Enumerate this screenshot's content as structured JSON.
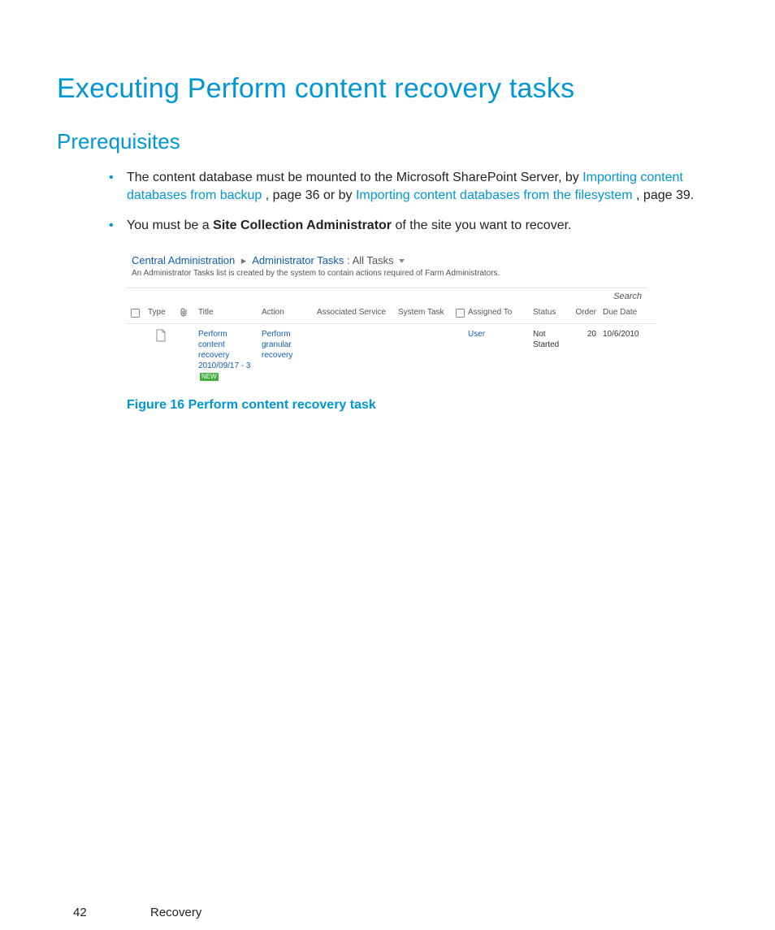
{
  "headings": {
    "h1": "Executing Perform content recovery tasks",
    "h2": "Prerequisites"
  },
  "bullets": [
    {
      "pre": "The content database must be mounted to the Microsoft SharePoint Server, by ",
      "link1": "Importing content databases from backup",
      "mid": ", page 36 or by ",
      "link2": "Importing content databases from the filesystem",
      "post": ", page 39."
    },
    {
      "pre": "You must be a ",
      "bold": "Site Collection Administrator",
      "post": " of the site you want to recover."
    }
  ],
  "screenshot": {
    "breadcrumb": {
      "root": "Central Administration",
      "list": "Administrator Tasks",
      "view": "All Tasks"
    },
    "description": "An Administrator Tasks list is created by the system to contain actions required of Farm Administrators.",
    "search_label": "Search",
    "headers": {
      "type": "Type",
      "title": "Title",
      "action": "Action",
      "assoc": "Associated Service",
      "system": "System Task",
      "assigned": "Assigned To",
      "status": "Status",
      "order": "Order",
      "due": "Due Date"
    },
    "row": {
      "title": "Perform content recovery 2010/09/17 - 3",
      "new": "NEW",
      "action": "Perform granular recovery",
      "assigned": "User",
      "status": "Not Started",
      "order": "20",
      "due": "10/6/2010"
    }
  },
  "figure_caption": "Figure 16 Perform content recovery task",
  "footer": {
    "page": "42",
    "section": "Recovery"
  }
}
